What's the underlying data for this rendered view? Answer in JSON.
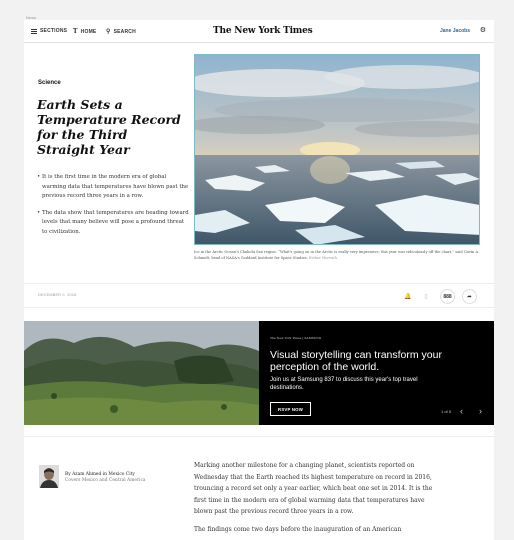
{
  "top_label": "News",
  "header": {
    "sections_label": "SECTIONS",
    "home_label": "HOME",
    "search_label": "SEARCH",
    "logo": "The New York Times",
    "user_name": "Jane Jacobs"
  },
  "article": {
    "kicker": "Science",
    "headline": "Earth Sets a Temperature Record for the Third Straight Year",
    "summary": [
      "It is the first time in the modern era of global warming data that temperatures have blown past the previous record three years in a row.",
      "The data show that temperatures are heading toward levels that many believe will pose a profound threat to civilization."
    ],
    "caption": "Ice in the Arctic Ocean's Chukchi Sea region. “What's going on in the Arctic is really very impressive; this year was ridiculously off the chart,” said Gavin A. Schmidt, head of NASA's Goddard Institute for Space Studies.",
    "caption_credit": "Esther Horvath",
    "date": "DECEMBER 0, 2016",
    "comment_count": "888"
  },
  "ad": {
    "brand": "The New York Times | SAMSUNG",
    "title": "Visual storytelling can transform your perception of the world.",
    "subtitle": "Join us at Samsung 837 to discuss this year's top travel destinations.",
    "cta": "RSVP NOW",
    "counter": "1 of 5"
  },
  "byline": {
    "author": "By Azam Ahmed in Mexico City",
    "role": "Covers Mexico and Central America"
  },
  "body": [
    "Marking another milestone for a changing planet, scientists reported on Wednesday that the Earth reached its highest temperature on record in 2016, trouncing a record set only a year earlier, which beat one set in 2014. It is the first time in the modern era of global warming data that temperatures have blown past the previous record three years in a row.",
    "The findings come two days before the inauguration of an American"
  ]
}
